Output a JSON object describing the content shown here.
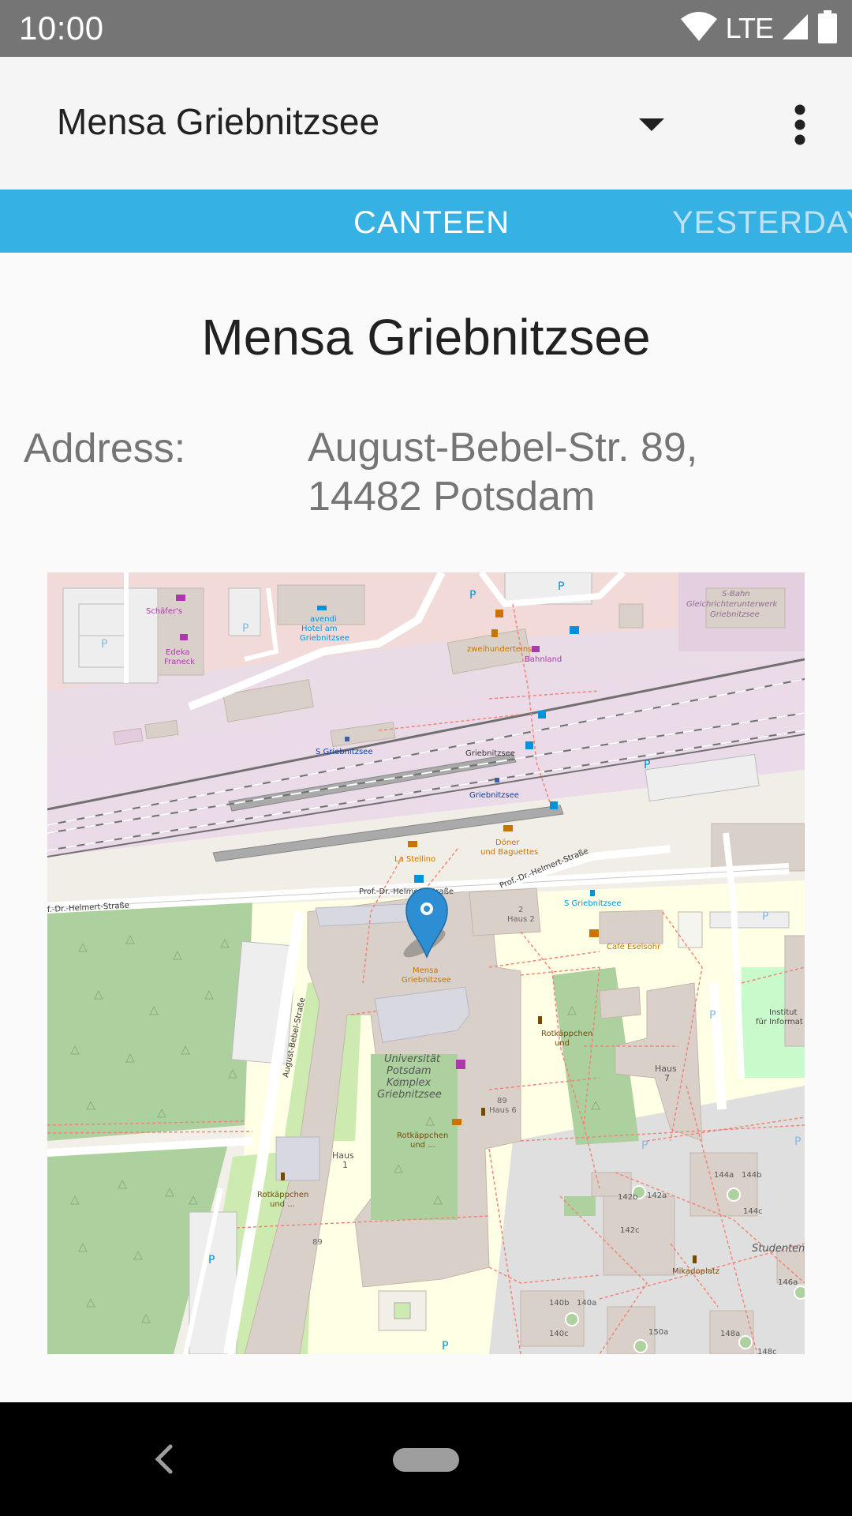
{
  "status_bar": {
    "time": "10:00",
    "network": "LTE",
    "icons": [
      "wifi-icon",
      "signal-icon",
      "battery-icon"
    ]
  },
  "app_bar": {
    "selected_canteen": "Mensa Griebnitzsee",
    "icons": [
      "dropdown-arrow-icon",
      "more-vert-icon"
    ]
  },
  "tabs": [
    {
      "label": "CANTEEN",
      "selected": true
    },
    {
      "label": "YESTERDAY",
      "selected": false
    }
  ],
  "canteen": {
    "name": "Mensa Griebnitzsee",
    "address_label": "Address:",
    "address_line1": "August-Bebel-Str. 89,",
    "address_line2": "14482 Potsdam"
  },
  "map": {
    "marker_icon": "location-pin-icon",
    "labels": {
      "schafers": "Schäfer's",
      "edeka": "Edeka",
      "edeka2": "Franeck",
      "avendi1": "avendi",
      "avendi2": "Hotel am",
      "avendi3": "Griebnitzsee",
      "sbahn1": "S-Bahn",
      "sbahn2": "Gleichrichterunterwerk",
      "sbahn3": "Griebnitzsee",
      "zweihundert": "zweihunderteins",
      "bahnland": "Bahnland",
      "s_griebnitzsee": "S Griebnitzsee",
      "griebnitzsee_station": "Griebnitzsee",
      "griebnitzsee_blue": "Griebnitzsee",
      "doner1": "Döner",
      "doner2": "und Baguettes",
      "la_stellino": "La Stellino",
      "prof_helmert_1": "Prof.-Dr.-Helmert-Straße",
      "prof_helmert_2": "Prof.-Dr.-Helmert-Straße",
      "prof_helmert_3": "f.-Dr.-Helmert-Straße",
      "s_griebnitzsee_stop": "S Griebnitzsee",
      "haus2a": "2",
      "haus2b": "Haus 2",
      "cafe_eselsohr": "Café Eselsohr",
      "mensa1": "Mensa",
      "mensa2": "Griebnitzsee",
      "institut1": "Institut",
      "institut2": "für Informat",
      "august_bebel": "August-Bebel-Straße",
      "uni1": "Universität",
      "uni2": "Potsdam",
      "uni3": "Komplex",
      "uni4": "Griebnitzsee",
      "haus6a": "89",
      "haus6b": "Haus 6",
      "rotkappchen1a": "Rotkäppchen",
      "rotkappchen1b": "und ...",
      "rotkappchen2a": "Rotkäppchen",
      "rotkappchen2b": "und",
      "rotkappchen3a": "Rotkäppchen",
      "rotkappchen3b": "und ...",
      "haus7a": "Haus",
      "haus7b": "7",
      "haus1a": "Haus",
      "haus1b": "1",
      "num89": "89",
      "b142b": "142b",
      "b142a": "142a",
      "b142c": "142c",
      "b144a": "144a",
      "b144b": "144b",
      "b144c": "144c",
      "studenten": "Studenten",
      "mikadoplatz": "Mikadoplatz",
      "b140b": "140b",
      "b140a": "140a",
      "b140c": "140c",
      "b150a": "150a",
      "b148a": "148a",
      "b146a": "146a",
      "b148c": "148c",
      "parking": "P"
    }
  },
  "nav_bar": {
    "icons": [
      "back-icon",
      "home-pill"
    ]
  }
}
